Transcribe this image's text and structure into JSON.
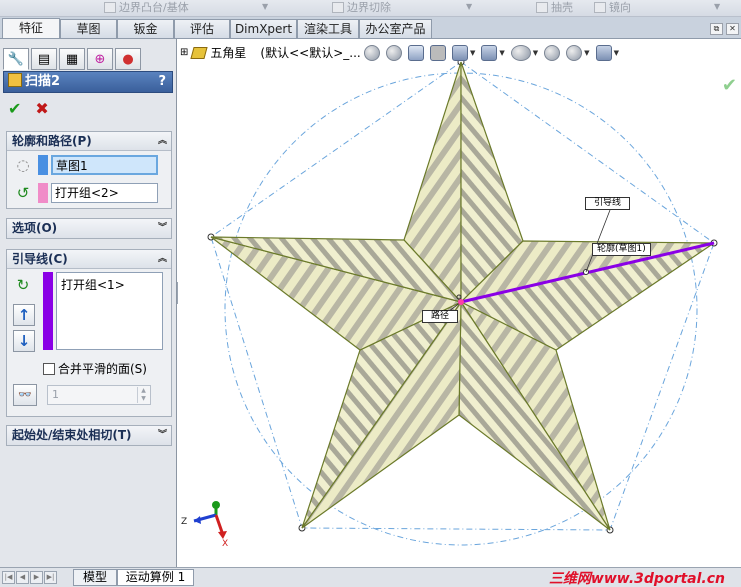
{
  "top_toolbar": {
    "items": [
      "边界凸台/基体",
      "边界切除",
      "抽壳",
      "镜向"
    ]
  },
  "tabs": [
    "特征",
    "草图",
    "钣金",
    "评估",
    "DimXpert",
    "渲染工具",
    "办公室产品"
  ],
  "active_tab": "特征",
  "property_manager": {
    "title": "扫描2",
    "help": "?",
    "ok_icon": "✔",
    "cancel_icon": "✖",
    "sections": {
      "profile_path": {
        "title": "轮廓和路径(P)",
        "profile_value": "草图1",
        "path_value": "打开组<2>"
      },
      "options": {
        "title": "选项(O)"
      },
      "guides": {
        "title": "引导线(C)",
        "list_items": [
          "打开组<1>"
        ],
        "up_icon": "↑",
        "down_icon": "↓",
        "merge_smooth_label": "合并平滑的面(S)",
        "spin_value": "1"
      },
      "start_end": {
        "title": "起始处/结束处相切(T)"
      }
    }
  },
  "viewport": {
    "tree_label": "五角星",
    "tree_config": "(默认<<默认>_...",
    "callouts": {
      "guide": "引导线",
      "profile": "轮廓(草图1)",
      "path": "路径"
    },
    "triad": {
      "x": "X",
      "y": "Y",
      "z": "Z"
    }
  },
  "bottom_tabs": [
    "模型",
    "运动算例 1"
  ],
  "watermark": "三维网www.3dportal.cn",
  "colors": {
    "tab_bar": "#c9d2de",
    "header_blue": "#3a5f9b",
    "guide_purple": "#8a00e6",
    "profile_blue": "#4a90e2",
    "path_pink": "#f08cc8",
    "star_face": "#e9e7c0",
    "sketch_blue": "#6aa5dc"
  }
}
